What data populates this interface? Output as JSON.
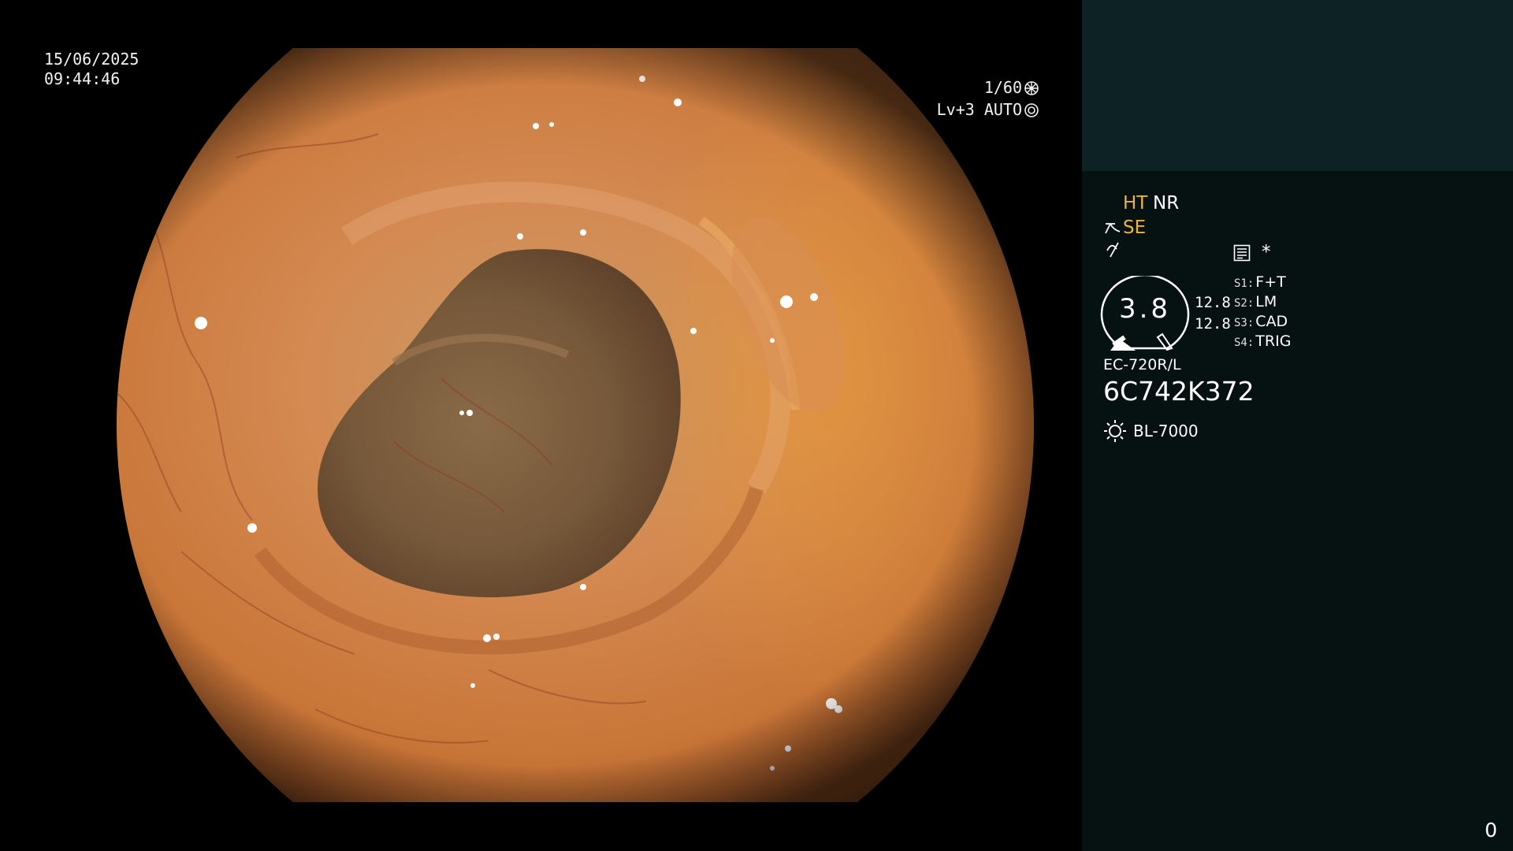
{
  "window": {
    "title": ""
  },
  "overlay": {
    "date": "15/06/2025",
    "time": "09:44:46",
    "shutter": "1/60",
    "shutter_icon": "shutter-icon",
    "iris": "Lv+3 AUTO",
    "iris_icon": "iris-icon"
  },
  "panel": {
    "mode_ht": "HT",
    "mode_nr": "NR",
    "mode_se": "SE",
    "star": "*",
    "gauge_value": "3.8",
    "gauge_side_1": "12.8",
    "gauge_side_2": "12.8",
    "switches": [
      {
        "label": "S1:",
        "value": "F+T"
      },
      {
        "label": "S2:",
        "value": "LM"
      },
      {
        "label": "S3:",
        "value": "CAD"
      },
      {
        "label": "S4:",
        "value": "TRIG"
      }
    ],
    "scope_model": "EC-720R/L",
    "scope_serial": "6C742K372",
    "light_source": "BL-7000",
    "counter": "0"
  },
  "colors": {
    "accent": "#f1b23a",
    "panel_bg": "#061112",
    "thumb_bg": "#0c2224",
    "mucosa": "#c8743a"
  }
}
